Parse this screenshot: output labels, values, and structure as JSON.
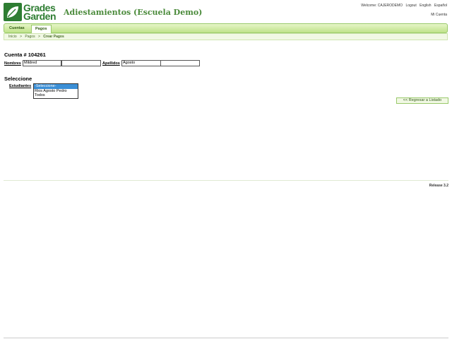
{
  "app": {
    "logo_line1": "Grades",
    "logo_line2": "Garden",
    "school_title": "Adiestamientos (Escuela Demo)",
    "accent_color": "#2e7d32"
  },
  "top_links": {
    "welcome": "Welcome: CAJERODEMO",
    "logout": "Logout",
    "english": "English",
    "espanol": "Español",
    "mi_cuenta": "Mi Cuenta"
  },
  "nav": {
    "tabs": [
      {
        "label": "Cuentas",
        "active": false
      },
      {
        "label": "Pagos",
        "active": true
      }
    ]
  },
  "breadcrumb": [
    "Inicio",
    "Pagos",
    "Crear Pagos"
  ],
  "account": {
    "title": "Cuenta # 104261",
    "nombres_label": "Nombres",
    "nombres_value": "Mildred",
    "apellidos_label": "Apellidos",
    "apellidos_value": "Agosto"
  },
  "select_section": {
    "title": "Seleccione",
    "estudiantes_label": "Estudiantes",
    "options": [
      "-Seleccione-",
      "Rios Agosto Pedro",
      "Todos"
    ],
    "selected_index": 0
  },
  "back_button": "<< Regresar a Listado",
  "release": "Release 3.2"
}
